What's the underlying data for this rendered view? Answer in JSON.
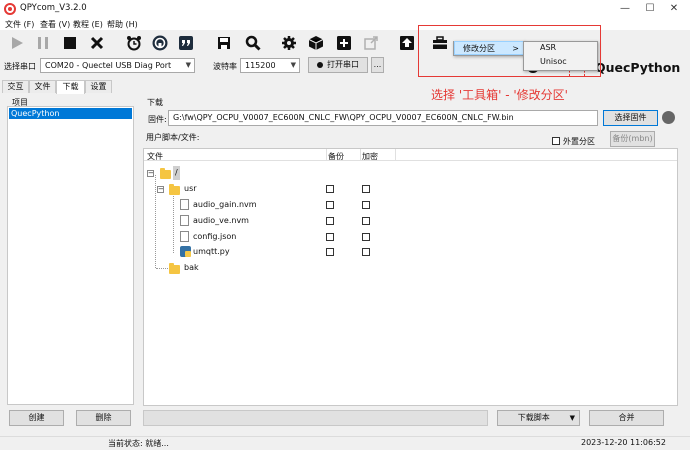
{
  "window": {
    "title": "QPYcom_V3.2.0"
  },
  "menu": [
    "文件 (F)",
    "查看 (V)",
    "教程 (E)",
    "帮助 (H)"
  ],
  "toolbar_icons": [
    "play-icon",
    "pause-icon",
    "stop-icon",
    "close-icon",
    "alarm-clock-icon",
    "terminal-icon",
    "quote-icon",
    "save-icon",
    "search-icon",
    "gear-icon",
    "cube-icon",
    "plus-icon",
    "external-link-icon",
    "upload-icon",
    "toolbox-icon"
  ],
  "port": {
    "label": "选择串口",
    "value": "COM20 - Quectel USB Diag Port",
    "baud_label": "波特率",
    "baud_value": "115200",
    "open_button": "打开串口",
    "more_button": "..."
  },
  "brand": "QuecPython",
  "tabs": [
    "交互",
    "文件",
    "下载",
    "设置"
  ],
  "active_tab": "下载",
  "left_panel": {
    "header": "项目",
    "items": [
      "QuecPython"
    ],
    "create_button": "创建",
    "delete_button": "删除"
  },
  "download": {
    "section_label": "下载",
    "firmware_label": "固件:",
    "firmware_path": "G:\\fw\\QPY_OCPU_V0007_EC600N_CNLC_FW\\QPY_OCPU_V0007_EC600N_CNLC_FW.bin",
    "select_firmware_button": "选择固件",
    "user_script_label": "用户脚本/文件:",
    "external_partition_label": "外置分区",
    "backup_button": "备份(mbn)",
    "columns": [
      "文件",
      "备份",
      "加密"
    ],
    "tree": [
      {
        "name": "/",
        "type": "folder",
        "level": 0,
        "expand": "⊟"
      },
      {
        "name": "usr",
        "type": "folder",
        "level": 1,
        "expand": "⊟"
      },
      {
        "name": "audio_gain.nvm",
        "type": "file",
        "level": 2
      },
      {
        "name": "audio_ve.nvm",
        "type": "file",
        "level": 2
      },
      {
        "name": "config.json",
        "type": "file",
        "level": 2
      },
      {
        "name": "umqtt.py",
        "type": "python",
        "level": 2
      },
      {
        "name": "bak",
        "type": "folder",
        "level": 1
      }
    ],
    "download_script_button": "下载脚本",
    "merge_button": "合并"
  },
  "popup": {
    "submenu_label": "修改分区",
    "submenu_arrow": ">",
    "options": [
      "ASR",
      "Unisoc"
    ]
  },
  "annotation": "选择 '工具箱' - '修改分区'",
  "status": {
    "text": "当前状态: 就绪...",
    "timestamp": "2023-12-20 11:06:52"
  },
  "colors": {
    "accent": "#0078d7",
    "annotation": "#e53935",
    "highlight": "#cce8ff"
  }
}
